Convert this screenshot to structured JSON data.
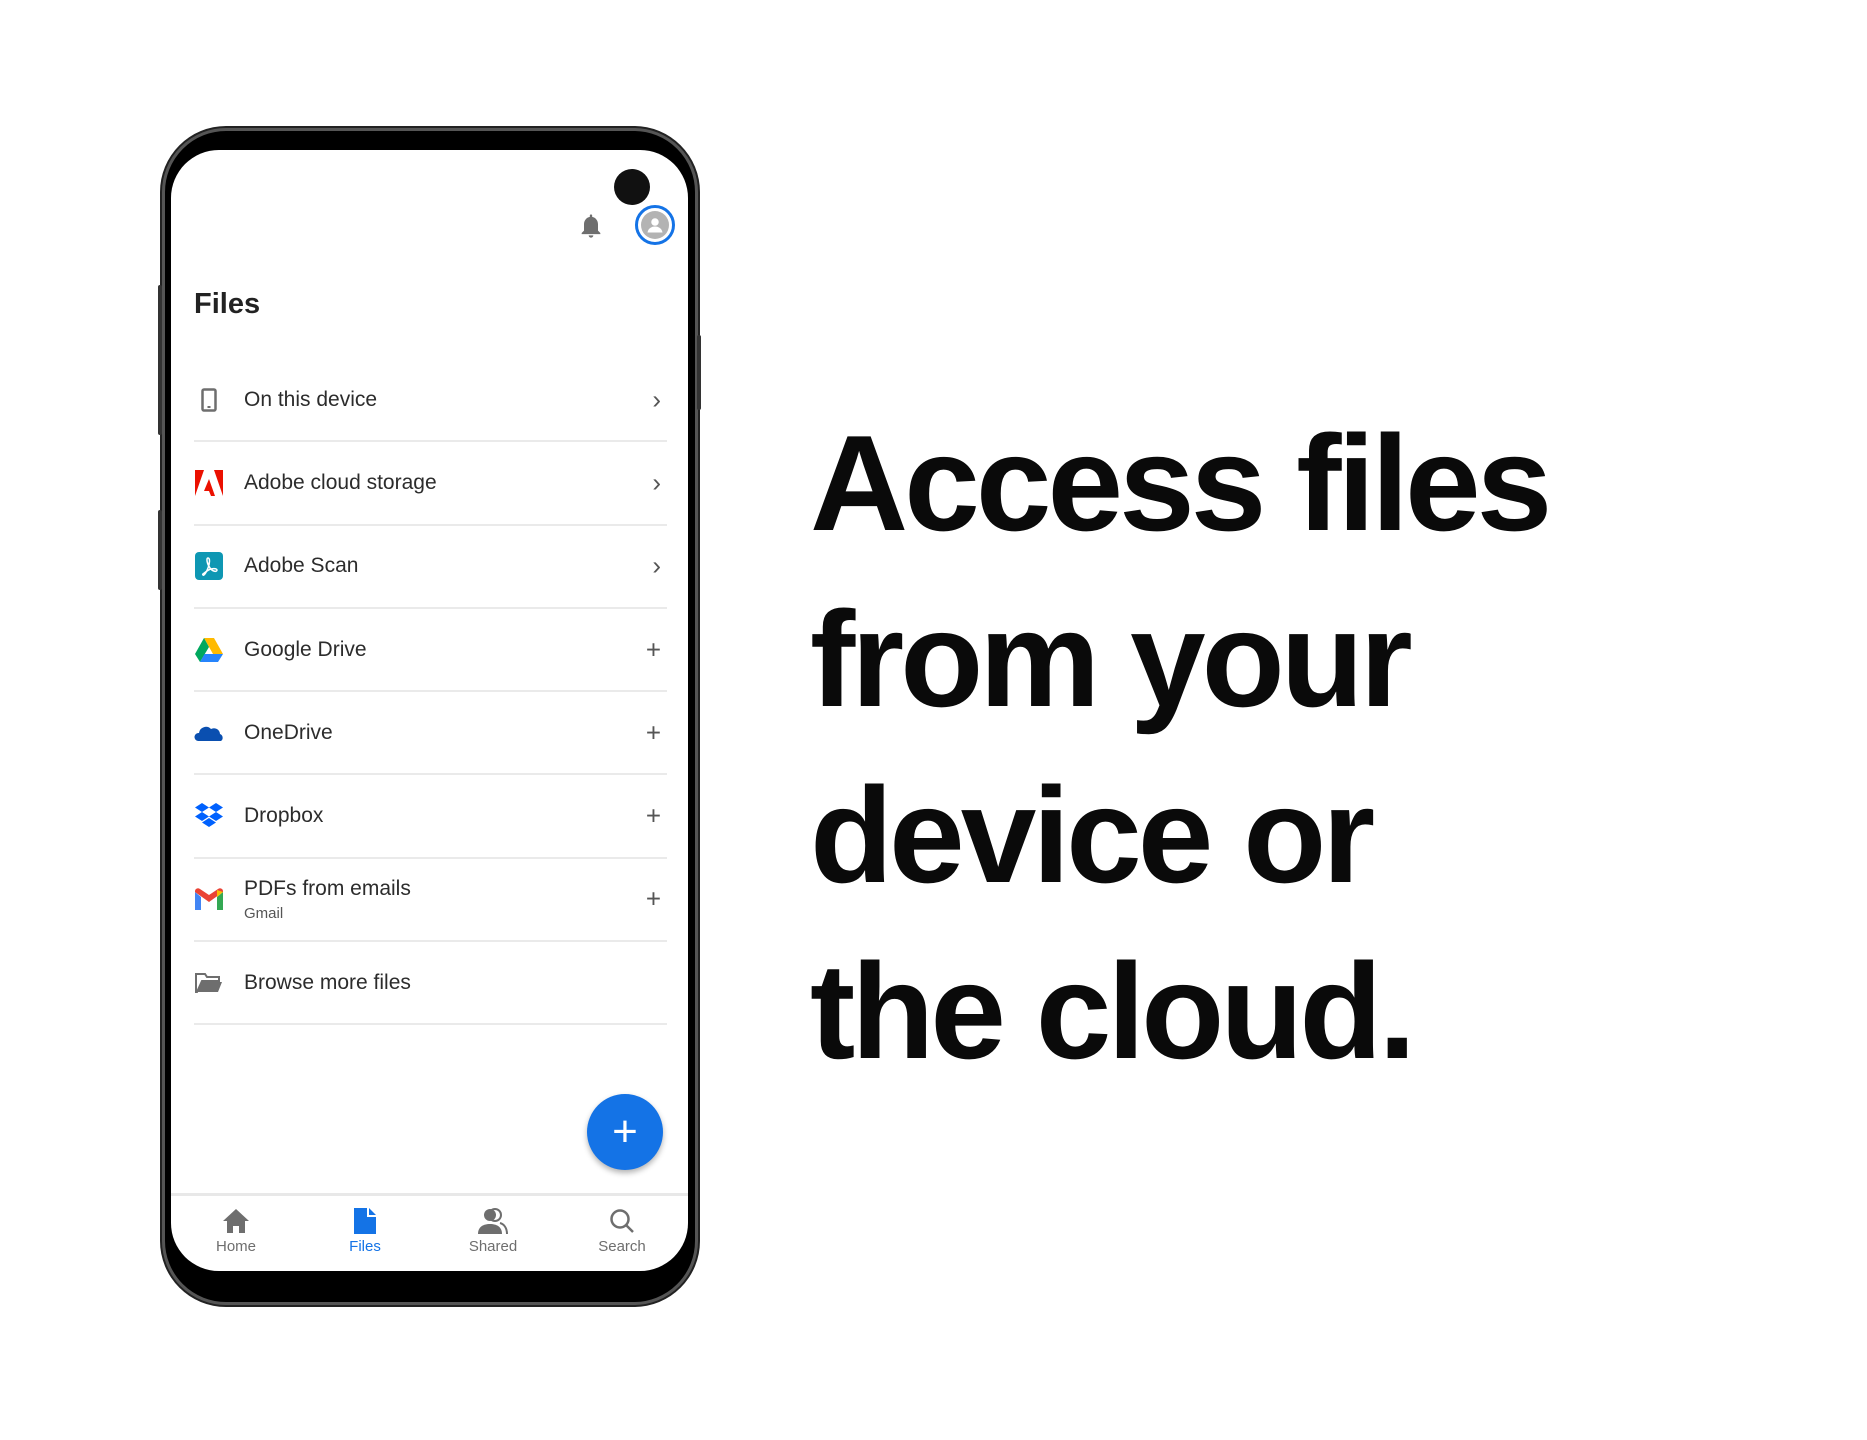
{
  "screen": {
    "title": "Files",
    "icons": {
      "notifications": "bell-icon",
      "profile": "avatar-icon"
    },
    "items": [
      {
        "label": "On this device",
        "icon": "phone-icon",
        "action": "chevron"
      },
      {
        "label": "Adobe cloud storage",
        "icon": "adobe-logo-icon",
        "action": "chevron"
      },
      {
        "label": "Adobe Scan",
        "icon": "adobe-scan-icon",
        "action": "chevron"
      },
      {
        "label": "Google Drive",
        "icon": "google-drive-icon",
        "action": "plus"
      },
      {
        "label": "OneDrive",
        "icon": "onedrive-icon",
        "action": "plus"
      },
      {
        "label": "Dropbox",
        "icon": "dropbox-icon",
        "action": "plus"
      },
      {
        "label": "PDFs from emails",
        "sublabel": "Gmail",
        "icon": "gmail-icon",
        "action": "plus"
      },
      {
        "label": "Browse more files",
        "icon": "folder-icon",
        "action": "none"
      }
    ],
    "fab": "+",
    "nav": [
      {
        "label": "Home"
      },
      {
        "label": "Files",
        "active": true
      },
      {
        "label": "Shared"
      },
      {
        "label": "Search"
      }
    ]
  },
  "colors": {
    "accent": "#1473e6",
    "adobe_red": "#eb1000"
  },
  "headline": {
    "line1": "Access files",
    "line2": "from your",
    "line3": "device or",
    "line4": "the cloud."
  }
}
